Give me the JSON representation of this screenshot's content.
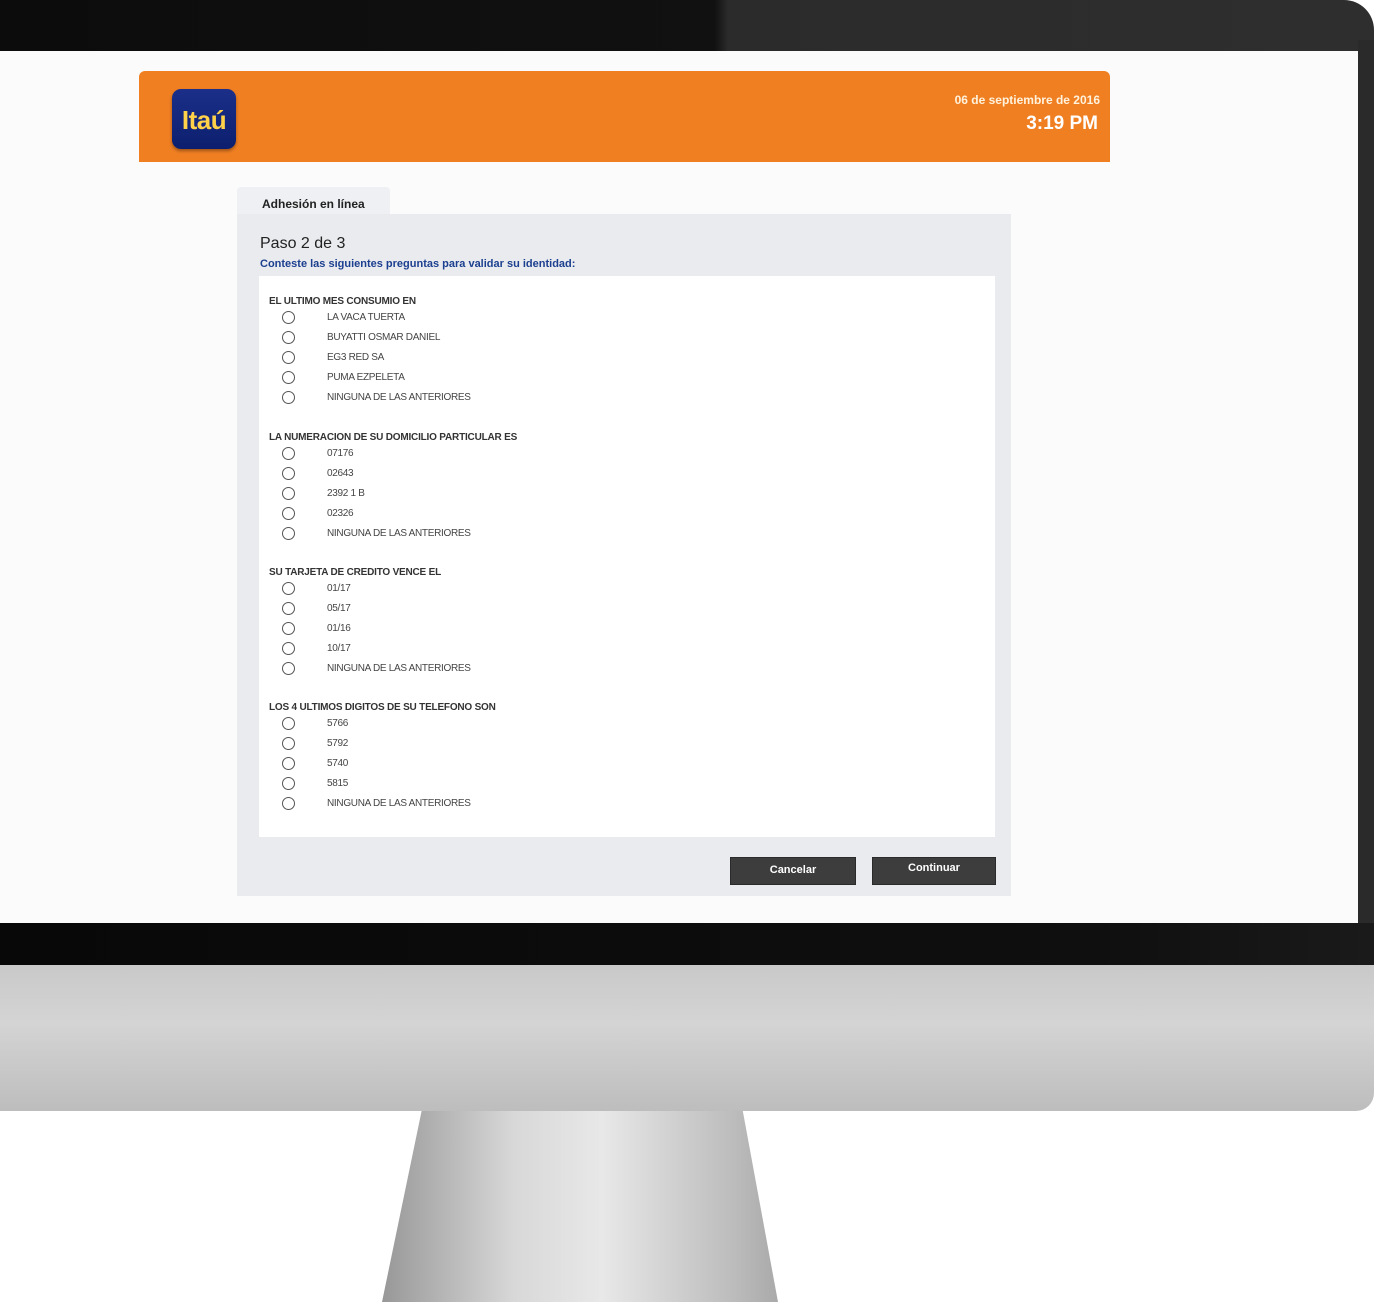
{
  "header": {
    "logo_text": "Itaú",
    "date": "06 de septiembre de 2016",
    "time": "3:19 PM",
    "brand_color": "#f07f22"
  },
  "tab": {
    "label": "Adhesión en línea"
  },
  "form": {
    "step": "Paso 2 de 3",
    "instruction": "Conteste las siguientes preguntas para validar su identidad:",
    "questions": [
      {
        "label": "EL ULTIMO MES CONSUMIO EN",
        "options": [
          "LA VACA TUERTA",
          "BUYATTI OSMAR DANIEL",
          "EG3 RED SA",
          "PUMA EZPELETA",
          "NINGUNA DE LAS ANTERIORES"
        ]
      },
      {
        "label": "LA NUMERACION DE SU DOMICILIO PARTICULAR ES",
        "options": [
          "07176",
          "02643",
          "2392 1 B",
          "02326",
          "NINGUNA DE LAS ANTERIORES"
        ]
      },
      {
        "label": "SU TARJETA DE CREDITO VENCE EL",
        "options": [
          "01/17",
          "05/17",
          "01/16",
          "10/17",
          "NINGUNA DE LAS ANTERIORES"
        ]
      },
      {
        "label": "LOS 4 ULTIMOS DIGITOS DE SU TELEFONO SON",
        "options": [
          "5766",
          "5792",
          "5740",
          "5815",
          "NINGUNA DE LAS ANTERIORES"
        ]
      }
    ]
  },
  "buttons": {
    "cancel": "Cancelar",
    "continue": "Continuar"
  }
}
